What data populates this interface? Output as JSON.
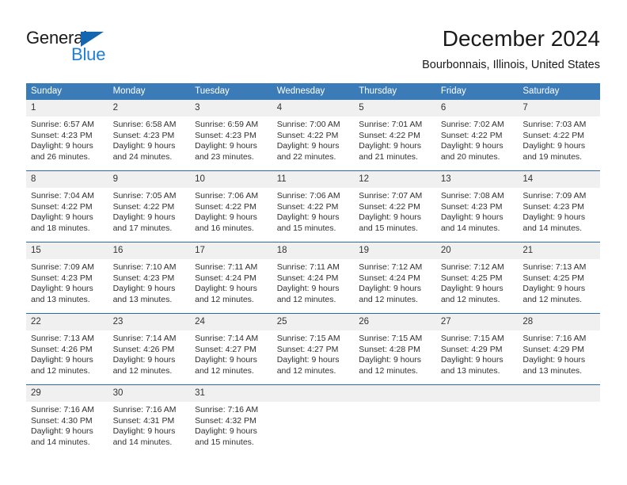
{
  "brand": {
    "name_top": "General",
    "name_bottom": "Blue",
    "accent_color": "#1f7fd4",
    "triangle_color": "#1566b0"
  },
  "header": {
    "title": "December 2024",
    "subtitle": "Bourbonnais, Illinois, United States"
  },
  "theme": {
    "header_row_bg": "#3b7cb8",
    "row_divider": "#2b6ca8",
    "daynum_bg": "#f0f0f0",
    "text": "#303030"
  },
  "weekdays": [
    "Sunday",
    "Monday",
    "Tuesday",
    "Wednesday",
    "Thursday",
    "Friday",
    "Saturday"
  ],
  "weeks": [
    [
      {
        "day": "1",
        "sunrise": "Sunrise: 6:57 AM",
        "sunset": "Sunset: 4:23 PM",
        "daylight1": "Daylight: 9 hours",
        "daylight2": "and 26 minutes."
      },
      {
        "day": "2",
        "sunrise": "Sunrise: 6:58 AM",
        "sunset": "Sunset: 4:23 PM",
        "daylight1": "Daylight: 9 hours",
        "daylight2": "and 24 minutes."
      },
      {
        "day": "3",
        "sunrise": "Sunrise: 6:59 AM",
        "sunset": "Sunset: 4:23 PM",
        "daylight1": "Daylight: 9 hours",
        "daylight2": "and 23 minutes."
      },
      {
        "day": "4",
        "sunrise": "Sunrise: 7:00 AM",
        "sunset": "Sunset: 4:22 PM",
        "daylight1": "Daylight: 9 hours",
        "daylight2": "and 22 minutes."
      },
      {
        "day": "5",
        "sunrise": "Sunrise: 7:01 AM",
        "sunset": "Sunset: 4:22 PM",
        "daylight1": "Daylight: 9 hours",
        "daylight2": "and 21 minutes."
      },
      {
        "day": "6",
        "sunrise": "Sunrise: 7:02 AM",
        "sunset": "Sunset: 4:22 PM",
        "daylight1": "Daylight: 9 hours",
        "daylight2": "and 20 minutes."
      },
      {
        "day": "7",
        "sunrise": "Sunrise: 7:03 AM",
        "sunset": "Sunset: 4:22 PM",
        "daylight1": "Daylight: 9 hours",
        "daylight2": "and 19 minutes."
      }
    ],
    [
      {
        "day": "8",
        "sunrise": "Sunrise: 7:04 AM",
        "sunset": "Sunset: 4:22 PM",
        "daylight1": "Daylight: 9 hours",
        "daylight2": "and 18 minutes."
      },
      {
        "day": "9",
        "sunrise": "Sunrise: 7:05 AM",
        "sunset": "Sunset: 4:22 PM",
        "daylight1": "Daylight: 9 hours",
        "daylight2": "and 17 minutes."
      },
      {
        "day": "10",
        "sunrise": "Sunrise: 7:06 AM",
        "sunset": "Sunset: 4:22 PM",
        "daylight1": "Daylight: 9 hours",
        "daylight2": "and 16 minutes."
      },
      {
        "day": "11",
        "sunrise": "Sunrise: 7:06 AM",
        "sunset": "Sunset: 4:22 PM",
        "daylight1": "Daylight: 9 hours",
        "daylight2": "and 15 minutes."
      },
      {
        "day": "12",
        "sunrise": "Sunrise: 7:07 AM",
        "sunset": "Sunset: 4:22 PM",
        "daylight1": "Daylight: 9 hours",
        "daylight2": "and 15 minutes."
      },
      {
        "day": "13",
        "sunrise": "Sunrise: 7:08 AM",
        "sunset": "Sunset: 4:23 PM",
        "daylight1": "Daylight: 9 hours",
        "daylight2": "and 14 minutes."
      },
      {
        "day": "14",
        "sunrise": "Sunrise: 7:09 AM",
        "sunset": "Sunset: 4:23 PM",
        "daylight1": "Daylight: 9 hours",
        "daylight2": "and 14 minutes."
      }
    ],
    [
      {
        "day": "15",
        "sunrise": "Sunrise: 7:09 AM",
        "sunset": "Sunset: 4:23 PM",
        "daylight1": "Daylight: 9 hours",
        "daylight2": "and 13 minutes."
      },
      {
        "day": "16",
        "sunrise": "Sunrise: 7:10 AM",
        "sunset": "Sunset: 4:23 PM",
        "daylight1": "Daylight: 9 hours",
        "daylight2": "and 13 minutes."
      },
      {
        "day": "17",
        "sunrise": "Sunrise: 7:11 AM",
        "sunset": "Sunset: 4:24 PM",
        "daylight1": "Daylight: 9 hours",
        "daylight2": "and 12 minutes."
      },
      {
        "day": "18",
        "sunrise": "Sunrise: 7:11 AM",
        "sunset": "Sunset: 4:24 PM",
        "daylight1": "Daylight: 9 hours",
        "daylight2": "and 12 minutes."
      },
      {
        "day": "19",
        "sunrise": "Sunrise: 7:12 AM",
        "sunset": "Sunset: 4:24 PM",
        "daylight1": "Daylight: 9 hours",
        "daylight2": "and 12 minutes."
      },
      {
        "day": "20",
        "sunrise": "Sunrise: 7:12 AM",
        "sunset": "Sunset: 4:25 PM",
        "daylight1": "Daylight: 9 hours",
        "daylight2": "and 12 minutes."
      },
      {
        "day": "21",
        "sunrise": "Sunrise: 7:13 AM",
        "sunset": "Sunset: 4:25 PM",
        "daylight1": "Daylight: 9 hours",
        "daylight2": "and 12 minutes."
      }
    ],
    [
      {
        "day": "22",
        "sunrise": "Sunrise: 7:13 AM",
        "sunset": "Sunset: 4:26 PM",
        "daylight1": "Daylight: 9 hours",
        "daylight2": "and 12 minutes."
      },
      {
        "day": "23",
        "sunrise": "Sunrise: 7:14 AM",
        "sunset": "Sunset: 4:26 PM",
        "daylight1": "Daylight: 9 hours",
        "daylight2": "and 12 minutes."
      },
      {
        "day": "24",
        "sunrise": "Sunrise: 7:14 AM",
        "sunset": "Sunset: 4:27 PM",
        "daylight1": "Daylight: 9 hours",
        "daylight2": "and 12 minutes."
      },
      {
        "day": "25",
        "sunrise": "Sunrise: 7:15 AM",
        "sunset": "Sunset: 4:27 PM",
        "daylight1": "Daylight: 9 hours",
        "daylight2": "and 12 minutes."
      },
      {
        "day": "26",
        "sunrise": "Sunrise: 7:15 AM",
        "sunset": "Sunset: 4:28 PM",
        "daylight1": "Daylight: 9 hours",
        "daylight2": "and 12 minutes."
      },
      {
        "day": "27",
        "sunrise": "Sunrise: 7:15 AM",
        "sunset": "Sunset: 4:29 PM",
        "daylight1": "Daylight: 9 hours",
        "daylight2": "and 13 minutes."
      },
      {
        "day": "28",
        "sunrise": "Sunrise: 7:16 AM",
        "sunset": "Sunset: 4:29 PM",
        "daylight1": "Daylight: 9 hours",
        "daylight2": "and 13 minutes."
      }
    ],
    [
      {
        "day": "29",
        "sunrise": "Sunrise: 7:16 AM",
        "sunset": "Sunset: 4:30 PM",
        "daylight1": "Daylight: 9 hours",
        "daylight2": "and 14 minutes."
      },
      {
        "day": "30",
        "sunrise": "Sunrise: 7:16 AM",
        "sunset": "Sunset: 4:31 PM",
        "daylight1": "Daylight: 9 hours",
        "daylight2": "and 14 minutes."
      },
      {
        "day": "31",
        "sunrise": "Sunrise: 7:16 AM",
        "sunset": "Sunset: 4:32 PM",
        "daylight1": "Daylight: 9 hours",
        "daylight2": "and 15 minutes."
      },
      {
        "day": "",
        "sunrise": "",
        "sunset": "",
        "daylight1": "",
        "daylight2": ""
      },
      {
        "day": "",
        "sunrise": "",
        "sunset": "",
        "daylight1": "",
        "daylight2": ""
      },
      {
        "day": "",
        "sunrise": "",
        "sunset": "",
        "daylight1": "",
        "daylight2": ""
      },
      {
        "day": "",
        "sunrise": "",
        "sunset": "",
        "daylight1": "",
        "daylight2": ""
      }
    ]
  ]
}
